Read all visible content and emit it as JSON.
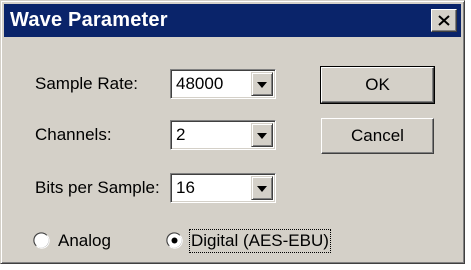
{
  "window": {
    "title": "Wave Parameter"
  },
  "fields": {
    "sample_rate": {
      "label": "Sample Rate:",
      "value": "48000"
    },
    "channels": {
      "label": "Channels:",
      "value": "2"
    },
    "bits_per_sample": {
      "label": "Bits per Sample:",
      "value": "16"
    }
  },
  "buttons": {
    "ok": "OK",
    "cancel": "Cancel"
  },
  "input_type": {
    "options": [
      {
        "label": "Analog",
        "selected": false
      },
      {
        "label": "Digital (AES-EBU)",
        "selected": true
      }
    ]
  },
  "icons": {
    "close": "close-icon",
    "dropdown": "chevron-down-icon",
    "radio": "radio-icon"
  },
  "colors": {
    "titlebar": "#0a246a",
    "face": "#d4d0c8"
  }
}
